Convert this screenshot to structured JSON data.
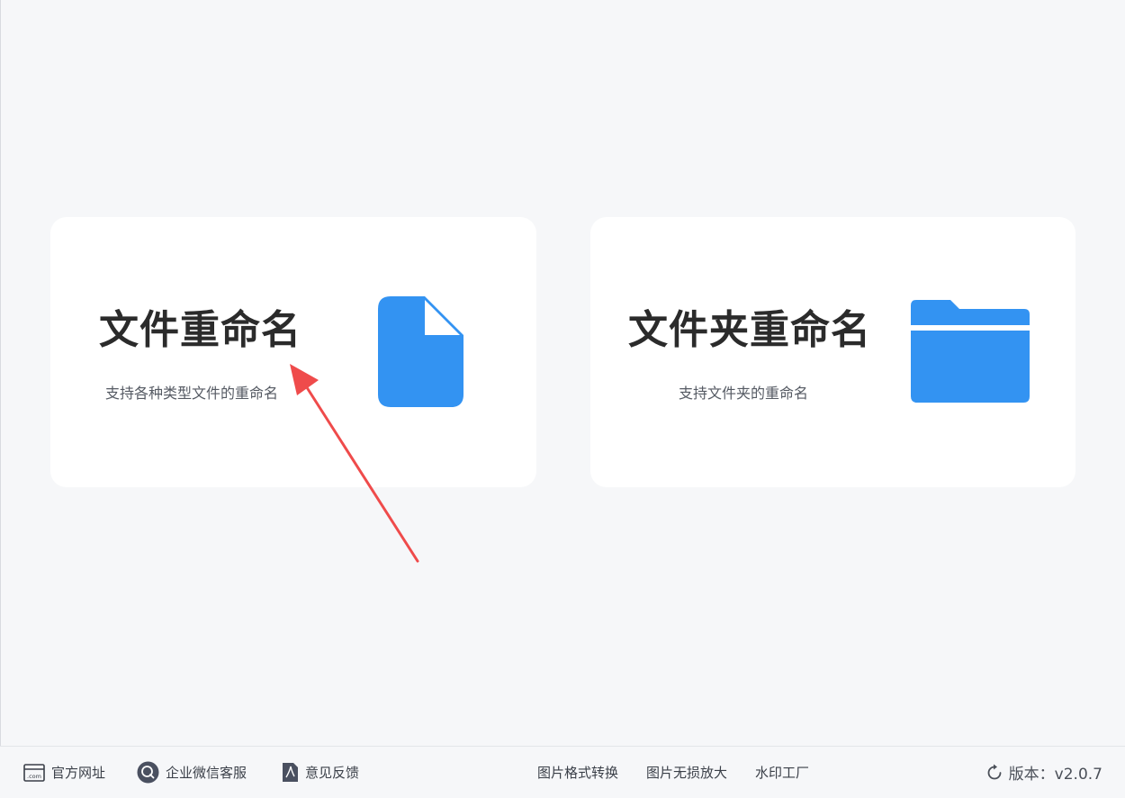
{
  "cards": {
    "file_rename": {
      "title": "文件重命名",
      "description": "支持各种类型文件的重命名",
      "icon": "file-icon"
    },
    "folder_rename": {
      "title": "文件夹重命名",
      "description": "支持文件夹的重命名",
      "icon": "folder-icon"
    }
  },
  "footer": {
    "left_links": [
      {
        "label": "官方网址",
        "icon": "website-icon"
      },
      {
        "label": "企业微信客服",
        "icon": "wechat-service-icon"
      },
      {
        "label": "意见反馈",
        "icon": "feedback-icon"
      }
    ],
    "center_links": [
      {
        "label": "图片格式转换"
      },
      {
        "label": "图片无损放大"
      },
      {
        "label": "水印工厂"
      }
    ],
    "version": {
      "label": "版本：v2.0.7",
      "icon": "refresh-icon"
    }
  },
  "colors": {
    "accent": "#3393f2",
    "background": "#f6f7f9",
    "card": "#ffffff",
    "annotation_arrow": "#ef4b4b"
  }
}
